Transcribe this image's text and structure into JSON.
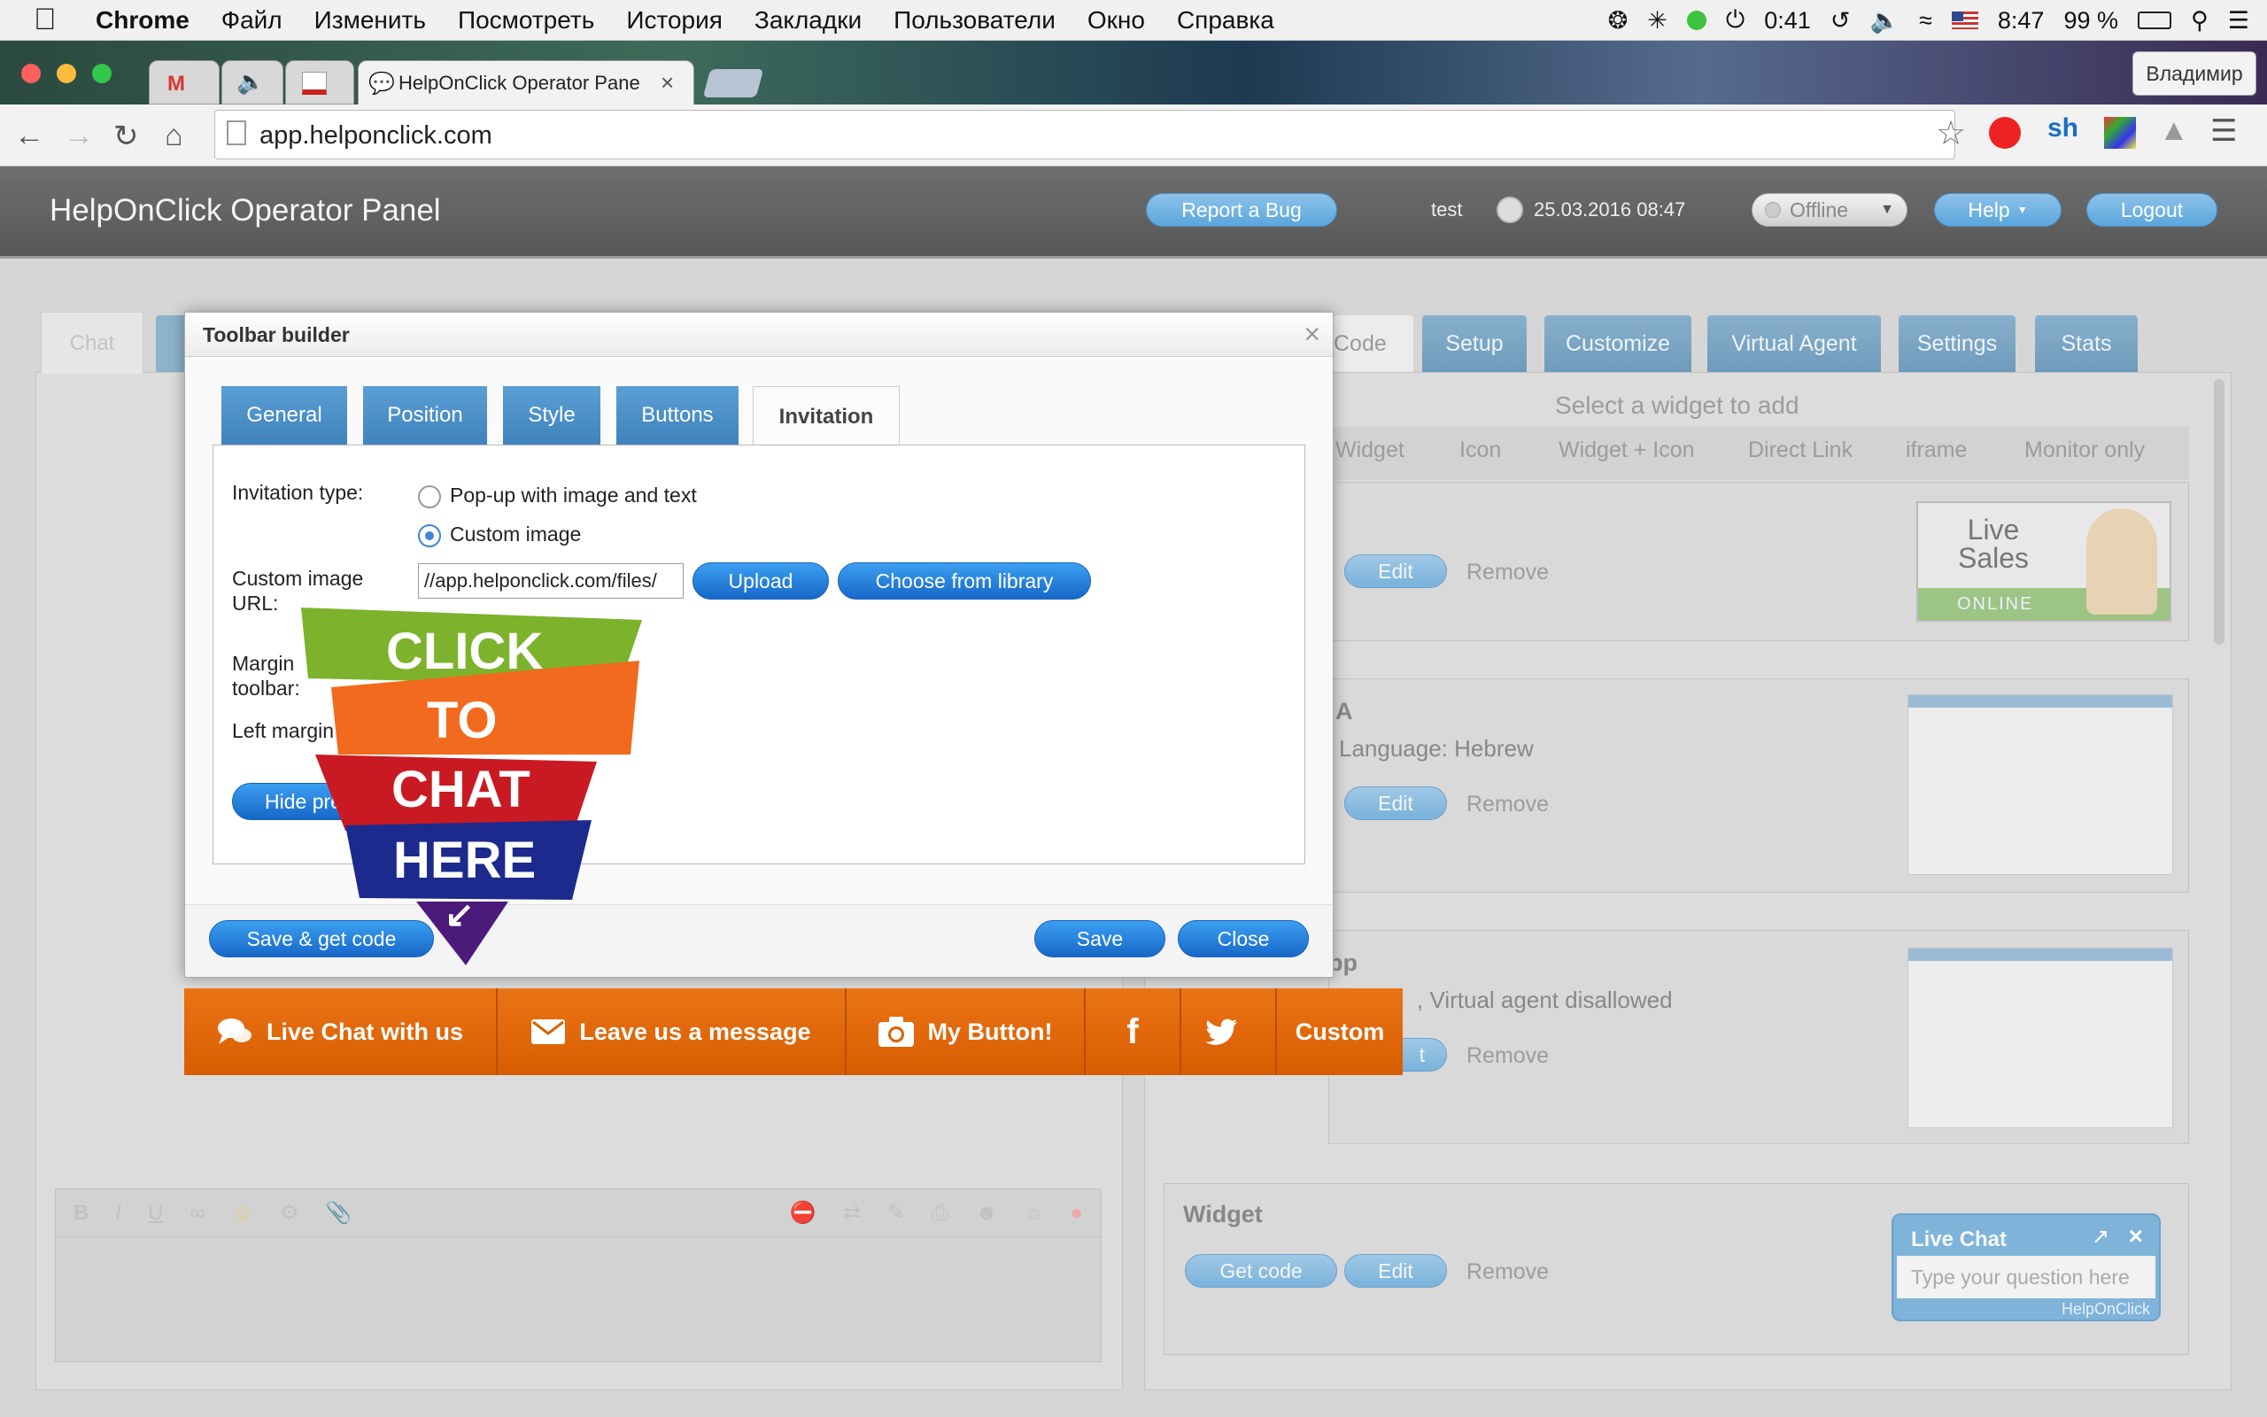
{
  "menubar": {
    "app": "Chrome",
    "items": [
      "Файл",
      "Изменить",
      "Посмотреть",
      "История",
      "Закладки",
      "Пользователи",
      "Окно",
      "Справка"
    ],
    "timer": "0:41",
    "time": "8:47",
    "battery": "99 %"
  },
  "browser": {
    "active_tab_title": "HelpOnClick Operator Pane",
    "profile": "Владимир",
    "url": "app.helponclick.com"
  },
  "header": {
    "title": "HelpOnClick Operator Panel",
    "report_bug": "Report a Bug",
    "user": "test",
    "datetime": "25.03.2016 08:47",
    "status": "Offline",
    "help": "Help",
    "logout": "Logout"
  },
  "left_panel": {
    "tab_chat": "Chat"
  },
  "right_panel": {
    "tabs": [
      "Code",
      "Setup",
      "Customize",
      "Virtual Agent",
      "Settings",
      "Stats"
    ],
    "select_widget": "Select a widget to add",
    "widget_types": [
      "Widget",
      "Icon",
      "Widget + Icon",
      "Direct Link",
      "iframe",
      "Monitor only"
    ],
    "card1": {
      "edit": "Edit",
      "remove": "Remove",
      "img_line1": "Live",
      "img_line2": "Sales",
      "img_badge": "ONLINE"
    },
    "card2": {
      "title": "A",
      "desc": "Language: Hebrew",
      "edit": "Edit",
      "remove": "Remove"
    },
    "card3": {
      "title": "pp",
      "desc": ", Virtual agent disallowed",
      "edit": "t",
      "remove": "Remove"
    },
    "card4": {
      "title": "Widget",
      "get_code": "Get code",
      "edit": "Edit",
      "remove": "Remove",
      "widget_title": "Live Chat",
      "widget_placeholder": "Type your question here",
      "widget_brand": "HelpOnClick"
    }
  },
  "modal": {
    "title": "Toolbar builder",
    "close_x": "×",
    "tabs": [
      "General",
      "Position",
      "Style",
      "Buttons",
      "Invitation"
    ],
    "invitation_type_label": "Invitation type:",
    "option1": "Pop-up with image and text",
    "option2": "Custom image",
    "custom_url_label_1": "Custom image",
    "custom_url_label_2": "URL:",
    "url_value": "//app.helponclick.com/files/",
    "upload": "Upload",
    "choose_library": "Choose from library",
    "margin_label_1": "Margin",
    "margin_label_2": "toolbar:",
    "left_margin_label": "Left margin",
    "hide_preview": "Hide pre",
    "save_get_code": "Save & get code",
    "save": "Save",
    "close": "Close"
  },
  "invitation_image": {
    "line1": "CLICK",
    "line2": "TO",
    "line3": "CHAT",
    "line4": "HERE",
    "arrow": "↙"
  },
  "chat_toolbar": {
    "buttons": [
      "Live Chat with us",
      "Leave us a message",
      "My Button!",
      "f",
      "",
      "Custom"
    ]
  },
  "colors": {
    "toolbar_orange": "#e06808",
    "tab_blue": "#4a8fc7",
    "primary_blue": "#2478d8"
  }
}
